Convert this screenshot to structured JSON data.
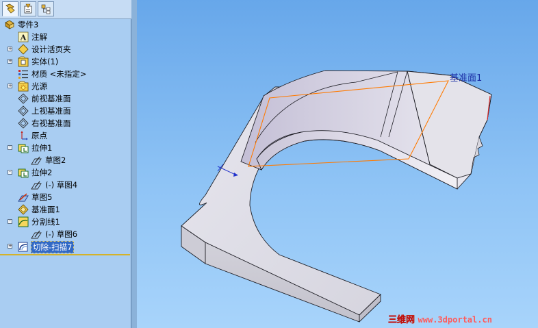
{
  "feature_tree": {
    "tabs": [
      {
        "name": "featuremanager-tab",
        "icon": "feature-manager-icon",
        "active": true
      },
      {
        "name": "propertymanager-tab",
        "icon": "property-manager-icon",
        "active": false
      },
      {
        "name": "configurationmanager-tab",
        "icon": "configuration-manager-icon",
        "active": false
      }
    ],
    "items": [
      {
        "label": "零件3",
        "icon": "part-icon",
        "expander": ""
      },
      {
        "label": "注解",
        "icon": "annotations-icon",
        "expander": ""
      },
      {
        "label": "设计活页夹",
        "icon": "design-binder-icon",
        "expander": "+"
      },
      {
        "label": "实体(1)",
        "icon": "solid-bodies-icon",
        "expander": "+"
      },
      {
        "label": "材质 <未指定>",
        "icon": "material-icon",
        "expander": ""
      },
      {
        "label": "光源",
        "icon": "lights-icon",
        "expander": "+"
      },
      {
        "label": "前视基准面",
        "icon": "plane-icon",
        "expander": ""
      },
      {
        "label": "上视基准面",
        "icon": "plane-icon",
        "expander": ""
      },
      {
        "label": "右视基准面",
        "icon": "plane-icon",
        "expander": ""
      },
      {
        "label": "原点",
        "icon": "origin-icon",
        "expander": ""
      },
      {
        "label": "拉伸1",
        "icon": "extrude-icon",
        "expander": "-"
      },
      {
        "label": "草图2",
        "icon": "sketch-icon",
        "expander": ""
      },
      {
        "label": "拉伸2",
        "icon": "extrude-icon",
        "expander": "-"
      },
      {
        "label": "(-) 草图4",
        "icon": "sketch-icon",
        "expander": ""
      },
      {
        "label": "草图5",
        "icon": "sketch-3d-icon",
        "expander": ""
      },
      {
        "label": "基准面1",
        "icon": "reference-plane-icon",
        "expander": ""
      },
      {
        "label": "分割线1",
        "icon": "split-line-icon",
        "expander": "-"
      },
      {
        "label": "(-) 草图6",
        "icon": "sketch-icon",
        "expander": ""
      },
      {
        "label": "切除-扫描7",
        "icon": "swept-cut-icon",
        "expander": "+",
        "selected": true
      }
    ]
  },
  "viewport": {
    "plane_label": "基准面1",
    "watermark_brand": "三维网",
    "watermark_url": "www.3dportal.cn"
  },
  "colors": {
    "panel_bg": "#a9cdf2",
    "selection": "#3169c6",
    "plane_outline": "#ff7a00",
    "model_face": "#dcdbe4"
  }
}
